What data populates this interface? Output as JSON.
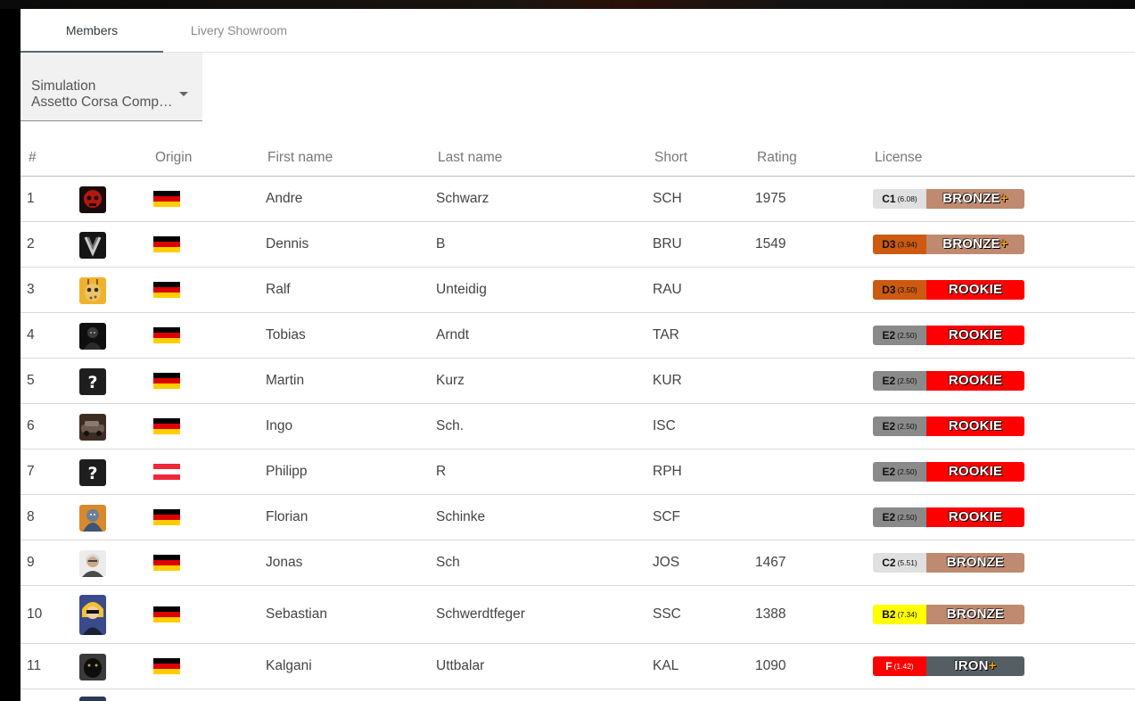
{
  "tabs": [
    {
      "label": "Members",
      "active": true
    },
    {
      "label": "Livery Showroom",
      "active": false
    }
  ],
  "simulation_select": {
    "label": "Simulation",
    "value": "Assetto Corsa Competizione"
  },
  "columns": [
    "#",
    "",
    "Origin",
    "First name",
    "Last name",
    "Short",
    "Rating",
    "License"
  ],
  "colors": {
    "tab_indicator": "#556b73",
    "bronze": "#bf8a6f",
    "rookie": "#ff0000",
    "iron": "#555f63",
    "class_c": "#e0e0e0",
    "class_d": "#cd5a10",
    "class_e": "#8a8a8a",
    "class_b": "#ffff00",
    "class_f": "#ff0000",
    "germany_flag": [
      "#000000",
      "#dd0000",
      "#ffce00"
    ],
    "austria_flag": [
      "#ed2939",
      "#ffffff",
      "#ed2939"
    ]
  },
  "members": [
    {
      "num": "1",
      "avatar": "red-skull-avatar-icon",
      "origin": "germany-flag-icon",
      "first": "Andre",
      "last": "Schwarz",
      "short": "SCH",
      "rating": "1975",
      "license_class": "C1",
      "safety_rating": "(6.08)",
      "tier": "BRONZE",
      "tier_plus": "+"
    },
    {
      "num": "2",
      "avatar": "dark-emblem-avatar-icon",
      "origin": "germany-flag-icon",
      "first": "Dennis",
      "last": "B",
      "short": "BRU",
      "rating": "1549",
      "license_class": "D3",
      "safety_rating": "(3.94)",
      "tier": "BRONZE",
      "tier_plus": "+"
    },
    {
      "num": "3",
      "avatar": "giraffe-avatar-icon",
      "origin": "germany-flag-icon",
      "first": "Ralf",
      "last": "Unteidig",
      "short": "RAU",
      "rating": "",
      "license_class": "D3",
      "safety_rating": "(3.50)",
      "tier": "ROOKIE",
      "tier_plus": ""
    },
    {
      "num": "4",
      "avatar": "dark-figure-avatar-icon",
      "origin": "germany-flag-icon",
      "first": "Tobias",
      "last": "Arndt",
      "short": "TAR",
      "rating": "",
      "license_class": "E2",
      "safety_rating": "(2.50)",
      "tier": "ROOKIE",
      "tier_plus": ""
    },
    {
      "num": "5",
      "avatar": "question-mark-avatar-icon",
      "origin": "germany-flag-icon",
      "first": "Martin",
      "last": "Kurz",
      "short": "KUR",
      "rating": "",
      "license_class": "E2",
      "safety_rating": "(2.50)",
      "tier": "ROOKIE",
      "tier_plus": ""
    },
    {
      "num": "6",
      "avatar": "car-photo-avatar-icon",
      "origin": "germany-flag-icon",
      "first": "Ingo",
      "last": "Sch.",
      "short": "ISC",
      "rating": "",
      "license_class": "E2",
      "safety_rating": "(2.50)",
      "tier": "ROOKIE",
      "tier_plus": ""
    },
    {
      "num": "7",
      "avatar": "question-mark-avatar-icon",
      "origin": "austria-flag-icon",
      "first": "Philipp",
      "last": "R",
      "short": "RPH",
      "rating": "",
      "license_class": "E2",
      "safety_rating": "(2.50)",
      "tier": "ROOKIE",
      "tier_plus": ""
    },
    {
      "num": "8",
      "avatar": "fantasy-character-avatar-icon",
      "origin": "germany-flag-icon",
      "first": "Florian",
      "last": "Schinke",
      "short": "SCF",
      "rating": "",
      "license_class": "E2",
      "safety_rating": "(2.50)",
      "tier": "ROOKIE",
      "tier_plus": ""
    },
    {
      "num": "9",
      "avatar": "old-man-avatar-icon",
      "origin": "germany-flag-icon",
      "first": "Jonas",
      "last": "Sch",
      "short": "JOS",
      "rating": "1467",
      "license_class": "C2",
      "safety_rating": "(5.51)",
      "tier": "BRONZE",
      "tier_plus": ""
    },
    {
      "num": "10",
      "avatar": "anime-character-avatar-icon",
      "origin": "germany-flag-icon",
      "first": "Sebastian",
      "last": "Schwerdtfeger",
      "short": "SSC",
      "rating": "1388",
      "license_class": "B2",
      "safety_rating": "(7.34)",
      "tier": "BRONZE",
      "tier_plus": ""
    },
    {
      "num": "11",
      "avatar": "black-panther-avatar-icon",
      "origin": "germany-flag-icon",
      "first": "Kalgani",
      "last": "Uttbalar",
      "short": "KAL",
      "rating": "1090",
      "license_class": "F",
      "safety_rating": "(1.42)",
      "tier": "IRON",
      "tier_plus": "+"
    }
  ]
}
